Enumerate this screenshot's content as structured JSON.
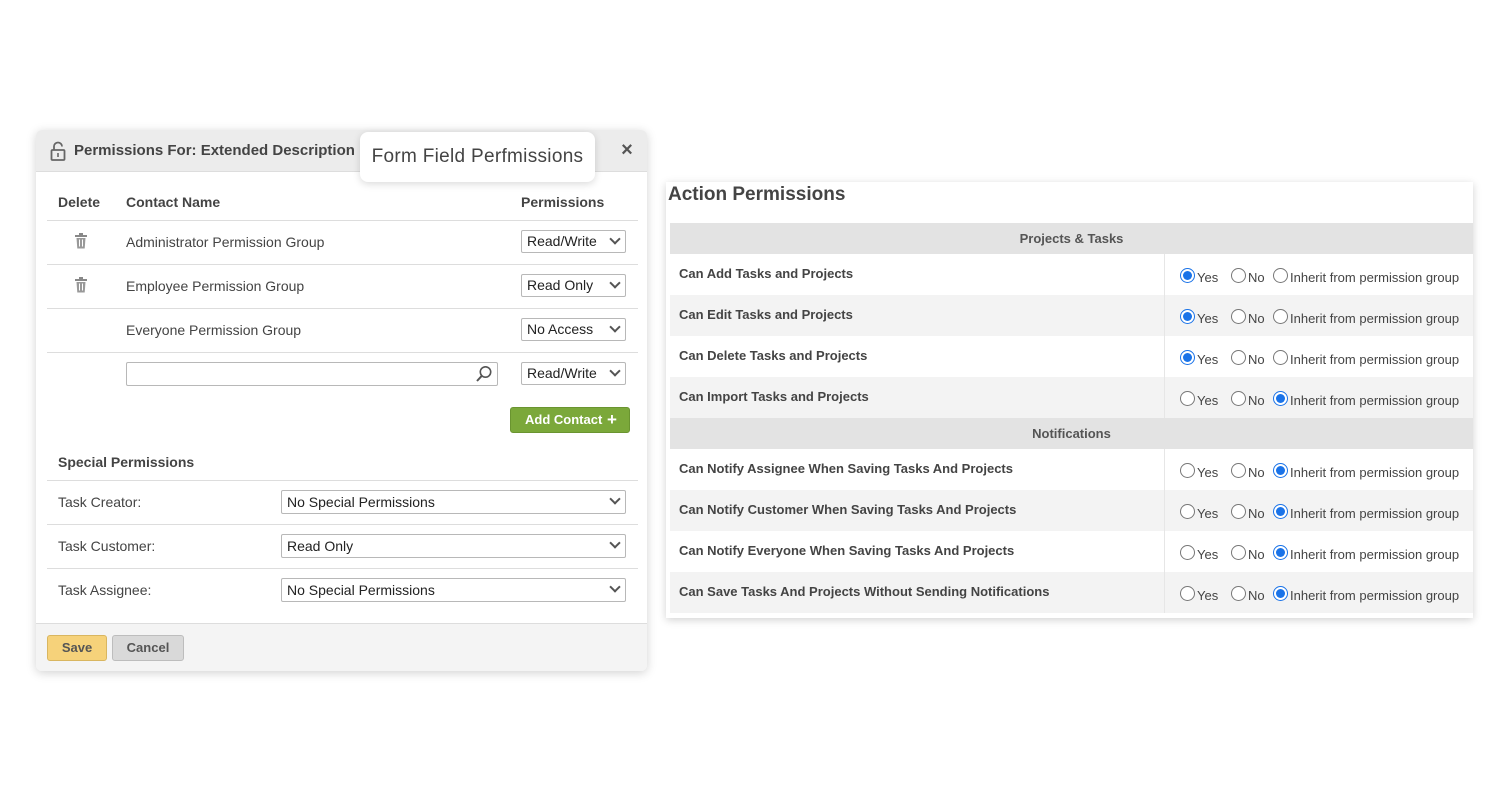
{
  "dialog": {
    "title": "Permissions For: Extended Description",
    "close_label": "×",
    "tooltip": "Form Field Perfmissions",
    "columns": {
      "delete": "Delete",
      "contact_name": "Contact Name",
      "permissions": "Permissions"
    },
    "rows": [
      {
        "name": "Administrator Permission Group",
        "permission": "Read/Write",
        "deletable": true
      },
      {
        "name": "Employee Permission Group",
        "permission": "Read Only",
        "deletable": true
      },
      {
        "name": "Everyone Permission Group",
        "permission": "No Access",
        "deletable": false
      }
    ],
    "new_contact": {
      "value": "",
      "permission": "Read/Write"
    },
    "add_contact_label": "Add Contact",
    "special_permissions": {
      "heading": "Special Permissions",
      "items": [
        {
          "label": "Task Creator:",
          "value": "No Special Permissions"
        },
        {
          "label": "Task Customer:",
          "value": "Read Only"
        },
        {
          "label": "Task Assignee:",
          "value": "No Special Permissions"
        }
      ]
    },
    "save_label": "Save",
    "cancel_label": "Cancel"
  },
  "action_permissions": {
    "title": "Action Permissions",
    "option_labels": {
      "yes": "Yes",
      "no": "No",
      "inherit": "Inherit from permission group"
    },
    "sections": [
      {
        "name": "Projects & Tasks",
        "rows": [
          {
            "label": "Can Add Tasks and Projects",
            "selected": "yes"
          },
          {
            "label": "Can Edit Tasks and Projects",
            "selected": "yes"
          },
          {
            "label": "Can Delete Tasks and Projects",
            "selected": "yes"
          },
          {
            "label": "Can Import Tasks and Projects",
            "selected": "inherit"
          }
        ]
      },
      {
        "name": "Notifications",
        "rows": [
          {
            "label": "Can Notify Assignee When Saving Tasks And Projects",
            "selected": "inherit"
          },
          {
            "label": "Can Notify Customer When Saving Tasks And Projects",
            "selected": "inherit"
          },
          {
            "label": "Can Notify Everyone When Saving Tasks And Projects",
            "selected": "inherit"
          },
          {
            "label": "Can Save Tasks And Projects Without Sending Notifications",
            "selected": "inherit"
          }
        ]
      }
    ]
  },
  "colors": {
    "accent_green": "#7ba83a",
    "save_yellow": "#f6d27a",
    "radio_blue": "#1a73e8"
  }
}
